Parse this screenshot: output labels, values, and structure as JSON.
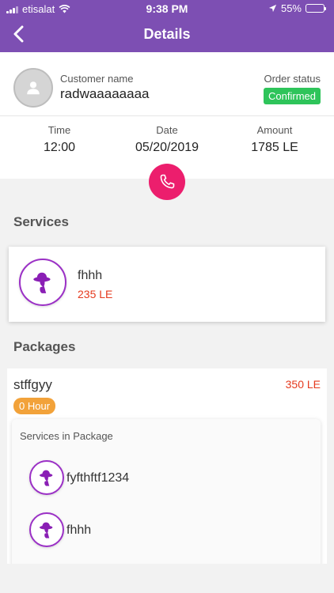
{
  "status_bar": {
    "carrier": "etisalat",
    "time": "9:38 PM",
    "battery": "55%",
    "battery_level": 0.55
  },
  "header": {
    "title": "Details",
    "back_icon": "chevron-left-icon"
  },
  "customer": {
    "name_label": "Customer name",
    "name": "radwaaaaaaaa",
    "status_label": "Order status",
    "status": "Confirmed",
    "status_color": "#2ec45a"
  },
  "order_info": {
    "time_label": "Time",
    "time": "12:00",
    "date_label": "Date",
    "date": "05/20/2019",
    "amount_label": "Amount",
    "amount": "1785 LE"
  },
  "call_button": {
    "icon": "phone-icon",
    "color": "#ec1e6d"
  },
  "services_section": {
    "title": "Services",
    "items": [
      {
        "name": "fhhh",
        "price": "235 LE",
        "icon": "hat-woman-icon"
      }
    ]
  },
  "packages_section": {
    "title": "Packages",
    "items": [
      {
        "name": "stffgyy",
        "price": "350 LE",
        "duration": "0 Hour",
        "services_title": "Services in Package",
        "services": [
          {
            "name": "fyfthftf1234"
          },
          {
            "name": "fhhh"
          }
        ]
      }
    ]
  },
  "colors": {
    "accent": "#7d4fb3",
    "price": "#e53a1e",
    "icon_ring": "#9b30c6",
    "duration_badge": "#f2a23a"
  }
}
